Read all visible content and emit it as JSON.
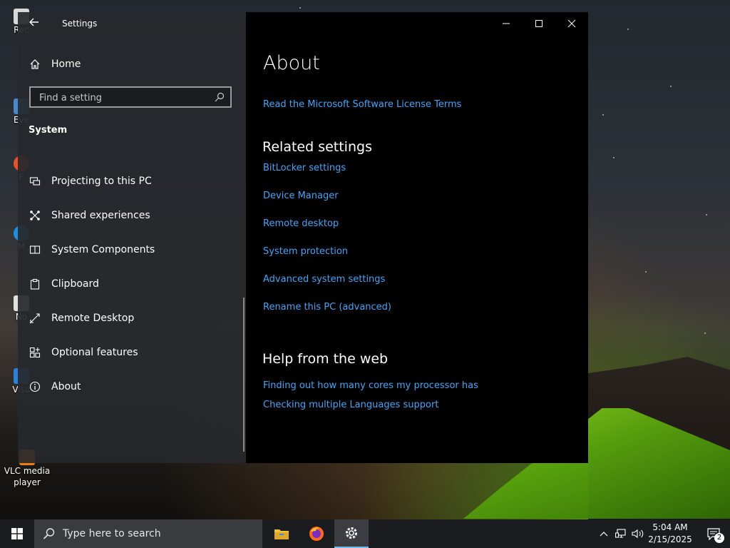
{
  "desktop": {
    "icons": [
      {
        "label": "Rec",
        "color": "#d8d8d8"
      },
      {
        "label": "Eve",
        "color": "#4a86c8"
      },
      {
        "label": "F",
        "color": "#e8522a"
      },
      {
        "label": "M",
        "color": "#1d8fe0"
      },
      {
        "label": "No",
        "color": "#e0e0e0"
      },
      {
        "label": "Visu",
        "color": "#2d7fd8"
      },
      {
        "label": "VLC media player",
        "color": "#f07c12"
      }
    ]
  },
  "window": {
    "app_title": "Settings",
    "controls": {
      "minimize": "—",
      "maximize": "☐",
      "close": "✕"
    }
  },
  "sidebar": {
    "home_label": "Home",
    "search_placeholder": "Find a setting",
    "section": "System",
    "items": [
      {
        "label": "Projecting to this PC",
        "icon": "projector-icon"
      },
      {
        "label": "Shared experiences",
        "icon": "shared-experiences-icon"
      },
      {
        "label": "System Components",
        "icon": "system-components-icon"
      },
      {
        "label": "Clipboard",
        "icon": "clipboard-icon"
      },
      {
        "label": "Remote Desktop",
        "icon": "remote-desktop-icon"
      },
      {
        "label": "Optional features",
        "icon": "optional-features-icon"
      },
      {
        "label": "About",
        "icon": "info-icon"
      }
    ]
  },
  "content": {
    "title": "About",
    "license_link": "Read the Microsoft Software License Terms",
    "related_heading": "Related settings",
    "related_links": [
      "BitLocker settings",
      "Device Manager",
      "Remote desktop",
      "System protection",
      "Advanced system settings",
      "Rename this PC (advanced)"
    ],
    "help_heading": "Help from the web",
    "help_links": [
      "Finding out how many cores my processor has",
      "Checking multiple Languages support"
    ]
  },
  "taskbar": {
    "search_placeholder": "Type here to search",
    "time": "5:04 AM",
    "date": "2/15/2025",
    "notification_count": "2"
  },
  "colors": {
    "link": "#4aa3f2",
    "accent": "#76b9ed"
  }
}
